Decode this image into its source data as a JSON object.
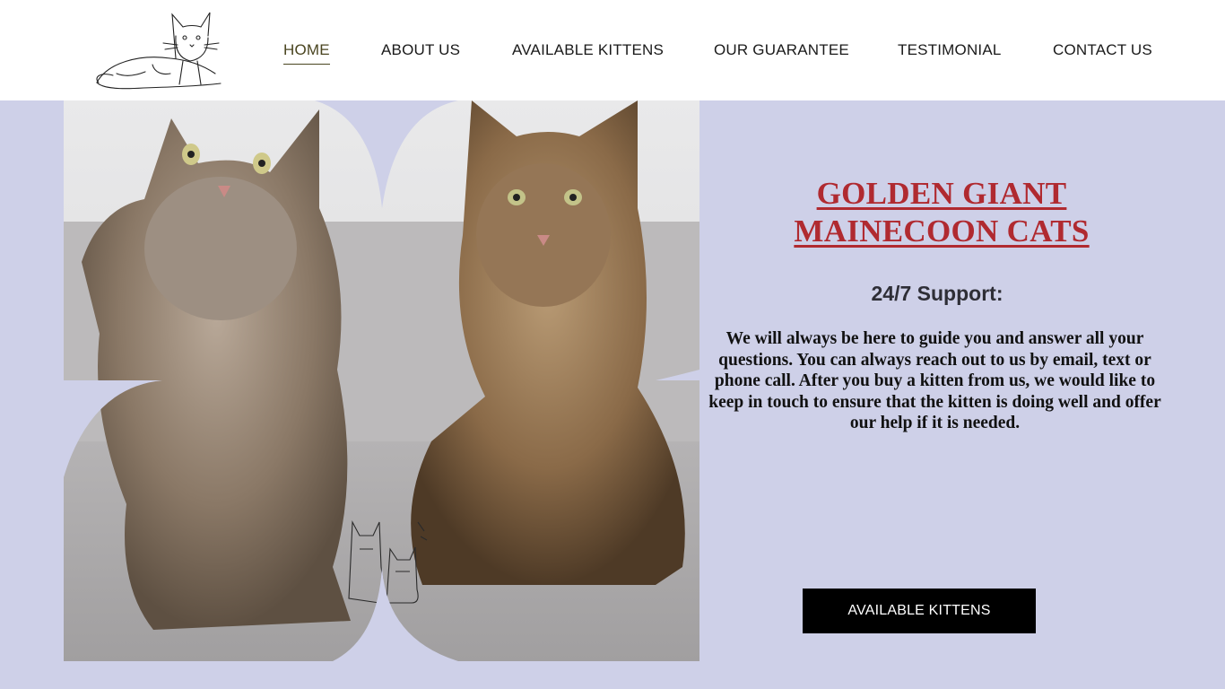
{
  "header": {
    "nav": [
      {
        "label": "HOME",
        "active": true
      },
      {
        "label": "ABOUT US",
        "active": false
      },
      {
        "label": "AVAILABLE KITTENS",
        "active": false
      },
      {
        "label": "OUR GUARANTEE",
        "active": false
      },
      {
        "label": "TESTIMONIAL",
        "active": false
      },
      {
        "label": "CONTACT US",
        "active": false
      }
    ]
  },
  "hero": {
    "title_line1": "GOLDEN GIANT",
    "title_line2": "MAINECOON CATS",
    "support_heading": "24/7 Support:",
    "support_text": "We will always be here to guide you and answer all your questions. You can always reach out to us by email, text or phone call. After you buy a kitten from us, we would like to keep in touch to ensure that the kitten is doing well and offer our help if it is needed.",
    "cta_label": "AVAILABLE KITTENS"
  },
  "colors": {
    "page_bg": "#ced0e8",
    "title": "#b02a30",
    "cta_bg": "#000000",
    "nav_active": "#4a4520"
  },
  "icons": [
    "cat-sketch-logo",
    "cat-pair-watermark"
  ]
}
